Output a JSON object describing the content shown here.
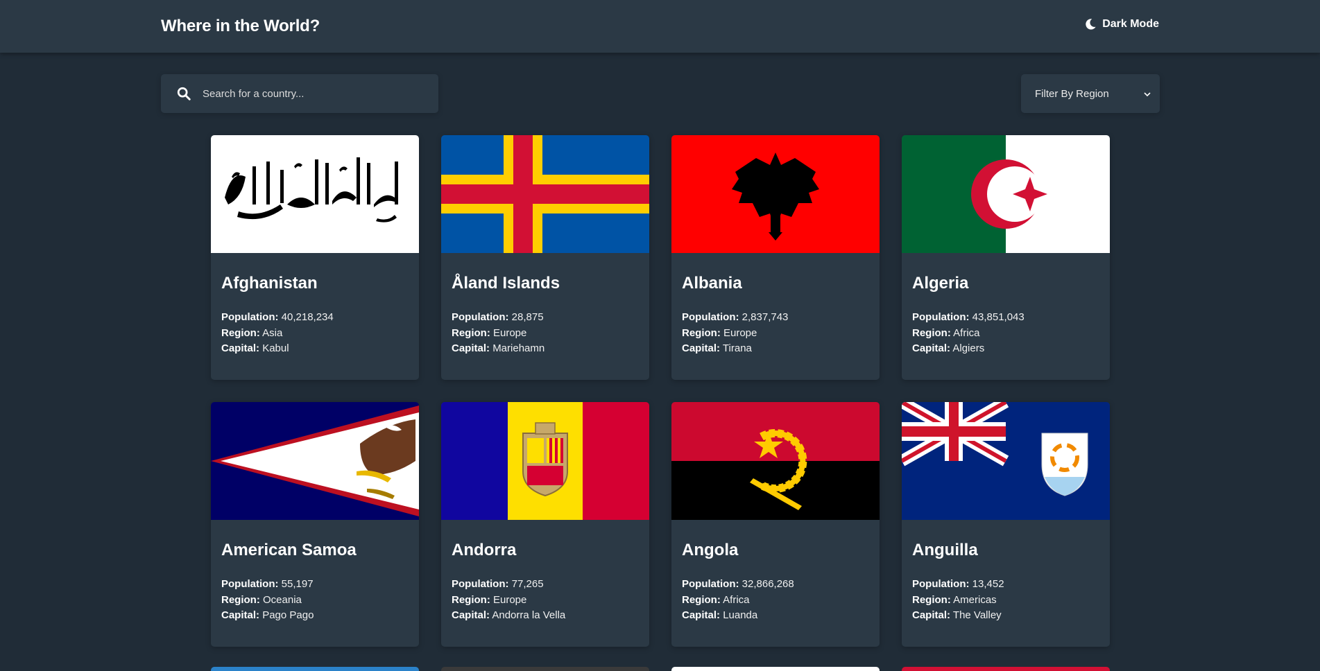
{
  "header": {
    "title": "Where in the World?",
    "dark_mode_label": "Dark Mode",
    "moon_icon": "moon-icon"
  },
  "search": {
    "placeholder": "Search for a country...",
    "value": "",
    "icon": "search-icon"
  },
  "filter": {
    "label": "Filter By Region",
    "icon": "chevron-down-icon"
  },
  "labels": {
    "population": "Population:",
    "region": "Region:",
    "capital": "Capital:"
  },
  "countries": [
    {
      "name": "Afghanistan",
      "population": "40,218,234",
      "region": "Asia",
      "capital": "Kabul"
    },
    {
      "name": "Åland Islands",
      "population": "28,875",
      "region": "Europe",
      "capital": "Mariehamn"
    },
    {
      "name": "Albania",
      "population": "2,837,743",
      "region": "Europe",
      "capital": "Tirana"
    },
    {
      "name": "Algeria",
      "population": "43,851,043",
      "region": "Africa",
      "capital": "Algiers"
    },
    {
      "name": "American Samoa",
      "population": "55,197",
      "region": "Oceania",
      "capital": "Pago Pago"
    },
    {
      "name": "Andorra",
      "population": "77,265",
      "region": "Europe",
      "capital": "Andorra la Vella"
    },
    {
      "name": "Angola",
      "population": "32,866,268",
      "region": "Africa",
      "capital": "Luanda"
    },
    {
      "name": "Anguilla",
      "population": "13,452",
      "region": "Americas",
      "capital": "The Valley"
    }
  ],
  "colors": {
    "background": "#202c37",
    "element": "#2b3945",
    "text": "#ffffff"
  }
}
